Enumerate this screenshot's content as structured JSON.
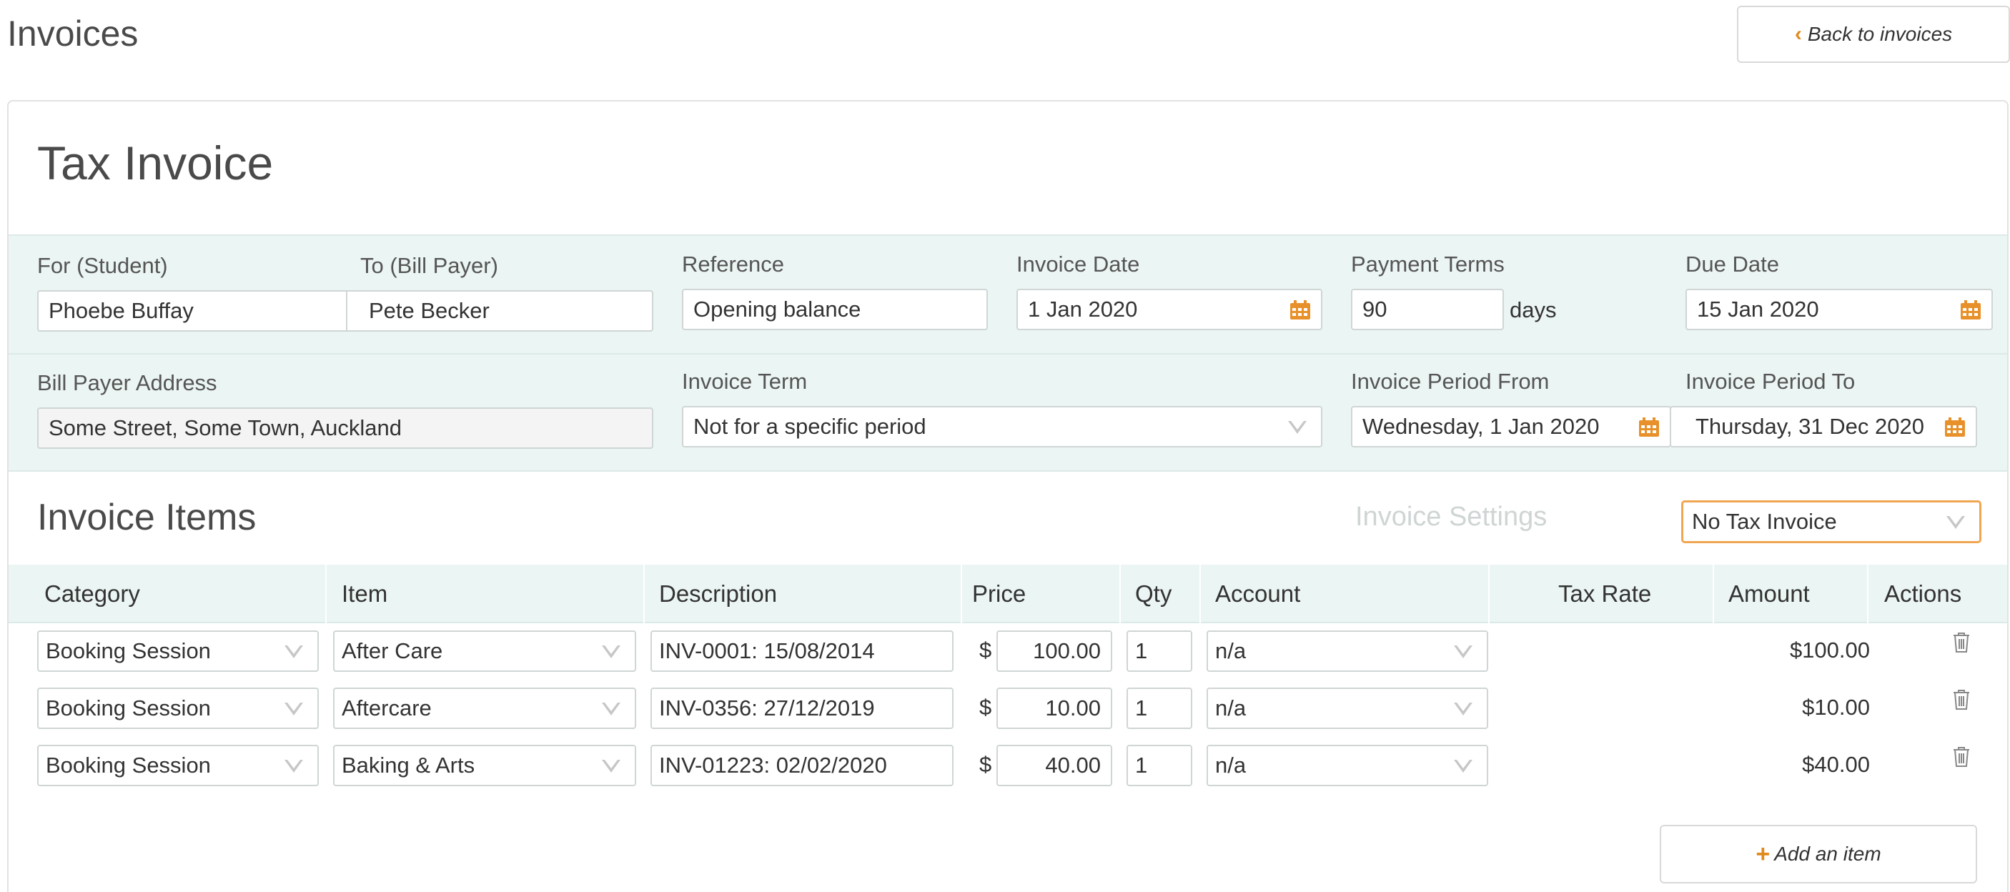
{
  "header": {
    "title": "Invoices",
    "back_label": "Back to invoices"
  },
  "invoice": {
    "title": "Tax Invoice",
    "for_student": {
      "label": "For (Student)",
      "value": "Phoebe Buffay"
    },
    "to_bill_payer": {
      "label": "To (Bill Payer)",
      "value": "Pete Becker"
    },
    "reference": {
      "label": "Reference",
      "value": "Opening balance"
    },
    "invoice_date": {
      "label": "Invoice Date",
      "value": "1 Jan 2020"
    },
    "payment_terms": {
      "label": "Payment Terms",
      "value": "90",
      "unit": "days"
    },
    "due_date": {
      "label": "Due Date",
      "value": "15 Jan 2020"
    },
    "bill_payer_address": {
      "label": "Bill Payer Address",
      "value": "Some Street, Some Town, Auckland"
    },
    "invoice_term": {
      "label": "Invoice Term",
      "value": "Not for a specific period"
    },
    "period_from": {
      "label": "Invoice Period From",
      "value": "Wednesday, 1 Jan 2020"
    },
    "period_to": {
      "label": "Invoice Period To",
      "value": "Thursday, 31 Dec 2020"
    }
  },
  "items_section": {
    "title": "Invoice Items",
    "settings_label": "Invoice Settings",
    "tax_mode": "No Tax Invoice",
    "columns": [
      "Category",
      "Item",
      "Description",
      "Price",
      "Qty",
      "Account",
      "Tax Rate",
      "Amount",
      "Actions"
    ],
    "currency": "$",
    "rows": [
      {
        "category": "Booking Session",
        "item": "After Care",
        "description": "INV-0001: 15/08/2014",
        "price": "100.00",
        "qty": "1",
        "account": "n/a",
        "amount": "$100.00"
      },
      {
        "category": "Booking Session",
        "item": "Aftercare",
        "description": "INV-0356: 27/12/2019",
        "price": "10.00",
        "qty": "1",
        "account": "n/a",
        "amount": "$10.00"
      },
      {
        "category": "Booking Session",
        "item": "Baking & Arts",
        "description": "INV-01223: 02/02/2020",
        "price": "40.00",
        "qty": "1",
        "account": "n/a",
        "amount": "$40.00"
      }
    ],
    "add_label": "Add an item"
  },
  "colors": {
    "accent": "#e08a1e",
    "band": "#ebf5f3",
    "focus_border": "#f0a650"
  },
  "icons": [
    "chevron-left-icon",
    "calendar-icon",
    "chevron-down-icon",
    "trash-icon",
    "plus-icon"
  ]
}
